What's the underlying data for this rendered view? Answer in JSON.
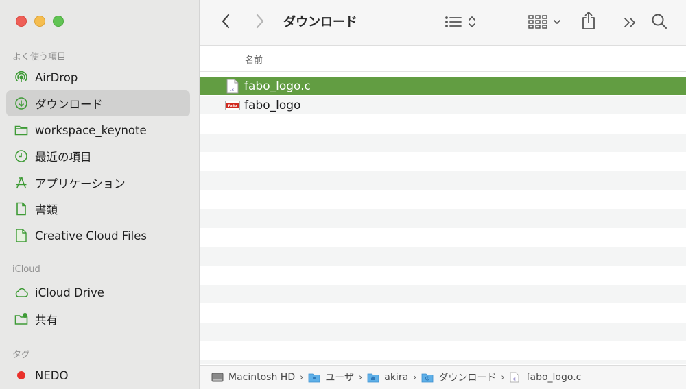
{
  "window": {
    "title": "ダウンロード"
  },
  "sidebar": {
    "favorites_header": "よく使う項目",
    "icloud_header": "iCloud",
    "tags_header": "タグ",
    "items": [
      {
        "label": "AirDrop",
        "icon": "airdrop-icon"
      },
      {
        "label": "ダウンロード",
        "icon": "download-icon",
        "selected": true
      },
      {
        "label": "workspace_keynote",
        "icon": "folder-icon"
      },
      {
        "label": "最近の項目",
        "icon": "clock-icon"
      },
      {
        "label": "アプリケーション",
        "icon": "applications-icon"
      },
      {
        "label": "書類",
        "icon": "document-icon"
      },
      {
        "label": "Creative Cloud Files",
        "icon": "cc-file-icon"
      }
    ],
    "icloud_items": [
      {
        "label": "iCloud Drive",
        "icon": "cloud-icon"
      },
      {
        "label": "共有",
        "icon": "shared-folder-icon"
      }
    ],
    "tags": [
      {
        "label": "NEDO",
        "color": "#e9312b"
      }
    ]
  },
  "list": {
    "column_name": "名前",
    "files": [
      {
        "name": "fabo_logo.c",
        "icon": "c-source-file-icon",
        "selected": true
      },
      {
        "name": "fabo_logo",
        "icon": "fabo-image-file-icon",
        "selected": false
      }
    ]
  },
  "pathbar": {
    "items": [
      {
        "label": "Macintosh HD",
        "icon": "hard-drive-icon"
      },
      {
        "label": "ユーザ",
        "icon": "users-folder-icon"
      },
      {
        "label": "akira",
        "icon": "home-folder-icon"
      },
      {
        "label": "ダウンロード",
        "icon": "downloads-folder-icon"
      },
      {
        "label": "fabo_logo.c",
        "icon": "c-file-icon"
      }
    ],
    "separator": "›"
  },
  "colors": {
    "accent": "#629d42",
    "sidebar_icon": "#3e9b36",
    "sidebar_bg": "#e8e8e7"
  }
}
